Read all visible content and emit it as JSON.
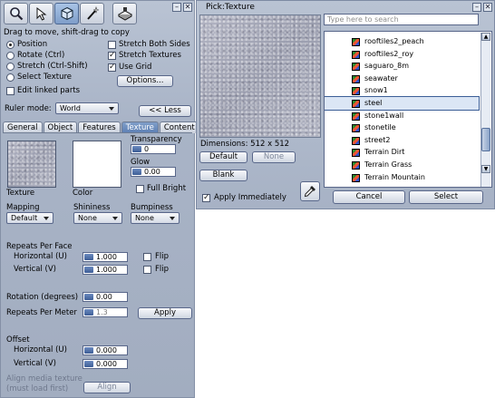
{
  "build": {
    "hint": "Drag to move, shift-drag to copy",
    "tools": [
      {
        "icon": "focus-magnifier-icon"
      },
      {
        "icon": "move-arrow-icon"
      },
      {
        "icon": "edit-cube-icon"
      },
      {
        "icon": "create-wand-icon"
      },
      {
        "icon": "land-tools-icon"
      }
    ],
    "modes": {
      "position": "Position",
      "rotate": "Rotate (Ctrl)",
      "stretch": "Stretch (Ctrl-Shift)",
      "select_texture": "Select Texture"
    },
    "checks": {
      "stretch_both": "Stretch Both Sides",
      "stretch_textures": "Stretch Textures",
      "use_grid": "Use Grid",
      "edit_linked": "Edit linked parts"
    },
    "options_label": "Options...",
    "ruler_label": "Ruler mode:",
    "ruler_value": "World",
    "less_label": "<< Less",
    "tabs": [
      "General",
      "Object",
      "Features",
      "Texture",
      "Content"
    ],
    "texture": {
      "transparency_label": "Transparency",
      "transparency_value": "0",
      "glow_label": "Glow",
      "glow_value": "0.00",
      "full_bright": "Full Bright",
      "texture_label": "Texture",
      "color_label": "Color",
      "mapping_label": "Mapping",
      "mapping_value": "Default",
      "shininess_label": "Shininess",
      "shininess_value": "None",
      "bumpiness_label": "Bumpiness",
      "bumpiness_value": "None",
      "repeats_face": "Repeats Per Face",
      "horizontal_u": "Horizontal (U)",
      "horizontal_u_value": "1.000",
      "vertical_v": "Vertical (V)",
      "vertical_v_value": "1.000",
      "flip": "Flip",
      "rotation_label": "Rotation (degrees)",
      "rotation_value": "0.00",
      "repeats_meter": "Repeats Per Meter",
      "repeats_meter_value": "1.3",
      "apply": "Apply",
      "offset": "Offset",
      "offset_h_label": "Horizontal (U)",
      "offset_h_value": "0.000",
      "offset_v_label": "Vertical (V)",
      "offset_v_value": "0.000",
      "align_media_1": "Align media texture",
      "align_media_2": "(must load first)",
      "align": "Align"
    }
  },
  "picker": {
    "title": "Pick:Texture",
    "dimensions": "Dimensions: 512 x 512",
    "default": "Default",
    "none": "None",
    "blank": "Blank",
    "apply_immediately": "Apply Immediately",
    "search_placeholder": "Type here to search",
    "cancel": "Cancel",
    "select": "Select",
    "items": [
      "rooftiles2_peach",
      "rooftiles2_roy",
      "saguaro_8m",
      "seawater",
      "snow1",
      "steel",
      "stone1wall",
      "stonetile",
      "street2",
      "Terrain Dirt",
      "Terrain Grass",
      "Terrain Mountain"
    ],
    "selected": "steel"
  },
  "colors": {
    "panel": "#a9b4c7",
    "accent": "#5b7eb3",
    "selection": "#dbe6f5"
  }
}
